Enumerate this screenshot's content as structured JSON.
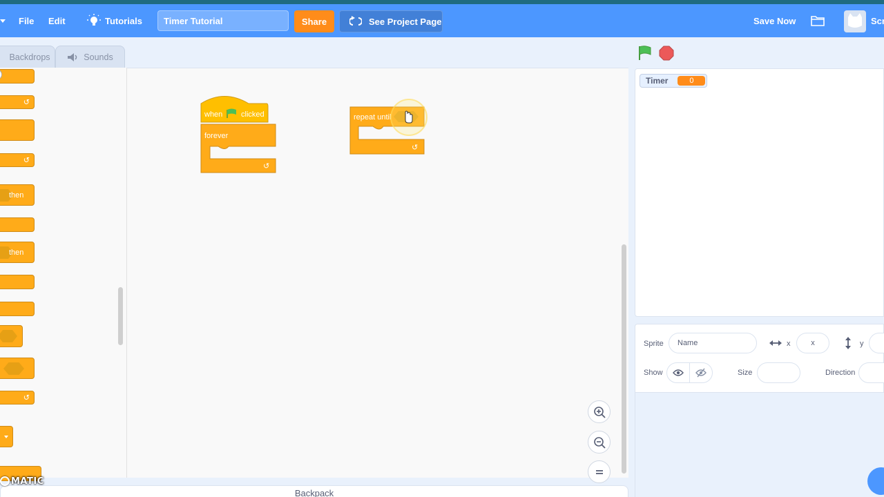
{
  "menu": {
    "file": "File",
    "edit": "Edit",
    "tutorials": "Tutorials",
    "project_title": "Timer Tutorial",
    "share": "Share",
    "see_project_page": "See Project Page",
    "save_now": "Save Now",
    "account_label": "Scr"
  },
  "tabs": {
    "backdrops": "Backdrops",
    "sounds": "Sounds"
  },
  "palette": {
    "then_1": "then",
    "then_2": "then"
  },
  "scripts": {
    "hat_when": "when",
    "hat_clicked": "clicked",
    "forever": "forever",
    "repeat_until": "repeat until"
  },
  "monitor": {
    "label": "Timer",
    "value": "0"
  },
  "sprite_info": {
    "sprite_label": "Sprite",
    "name_placeholder": "Name",
    "x_label": "x",
    "x_placeholder": "x",
    "y_label": "y",
    "show_label": "Show",
    "size_label": "Size",
    "direction_label": "Direction"
  },
  "backpack": "Backpack",
  "watermark": "MATIC",
  "colors": {
    "menubar": "#4c97ff",
    "control_block": "#ffab19",
    "share": "#ff8c1a",
    "green_flag": "#4cbf56",
    "stop": "#ec5959"
  }
}
